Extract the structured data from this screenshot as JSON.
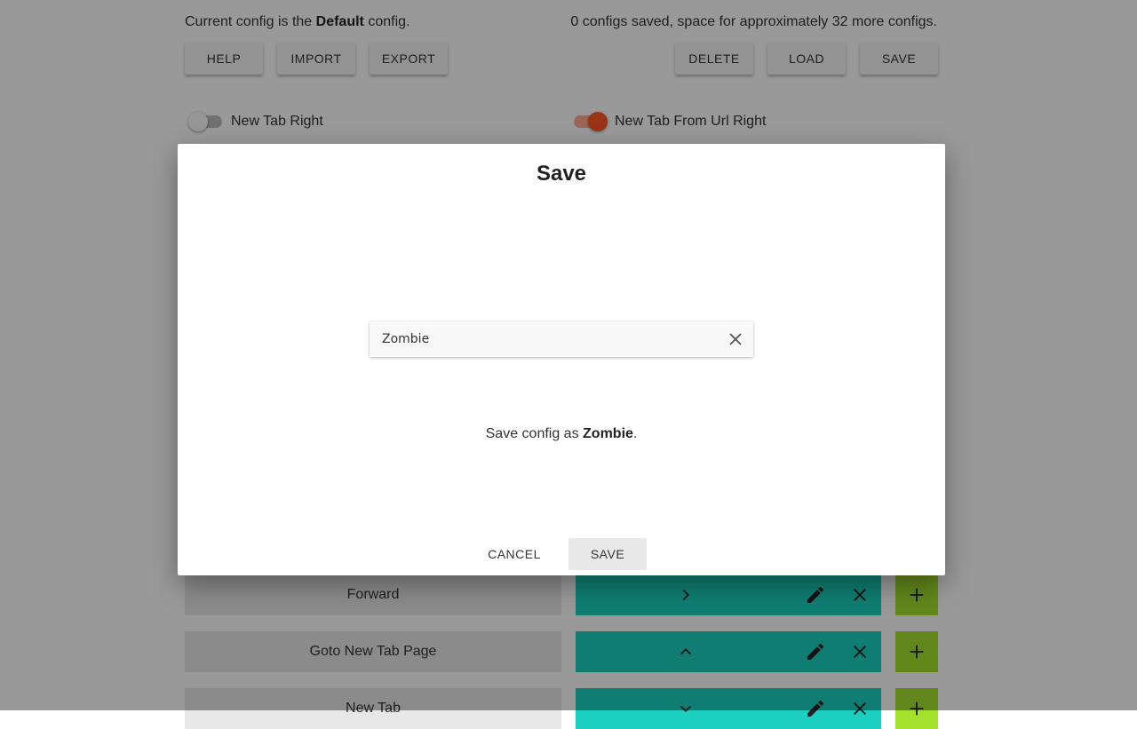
{
  "header": {
    "config_prefix": "Current config is the",
    "config_name": "Default",
    "config_suffix": "config.",
    "saved_status": "0 configs saved, space for approximately 32 more configs."
  },
  "toolbar": {
    "help": "HELP",
    "import": "IMPORT",
    "export": "EXPORT",
    "delete": "DELETE",
    "load": "LOAD",
    "save": "SAVE"
  },
  "toggles": [
    {
      "label": "New Tab Right",
      "on": false
    },
    {
      "label": "New Tab From Url Right",
      "on": true
    }
  ],
  "colors": {
    "accent_orange": "#ff5722",
    "teal": "#1bd0bf",
    "lime": "#a4e12d"
  },
  "rows": [
    {
      "label": "Forward",
      "key_icon": "chevron-right-icon"
    },
    {
      "label": "Goto New Tab Page",
      "key_icon": "chevron-up-icon"
    },
    {
      "label": "New Tab",
      "key_icon": "chevron-down-icon"
    }
  ],
  "dialog": {
    "title": "Save",
    "input_value": "Zombie",
    "message_prefix": "Save config as",
    "message_name": "Zombie",
    "message_suffix": ".",
    "cancel": "CANCEL",
    "save": "SAVE"
  }
}
